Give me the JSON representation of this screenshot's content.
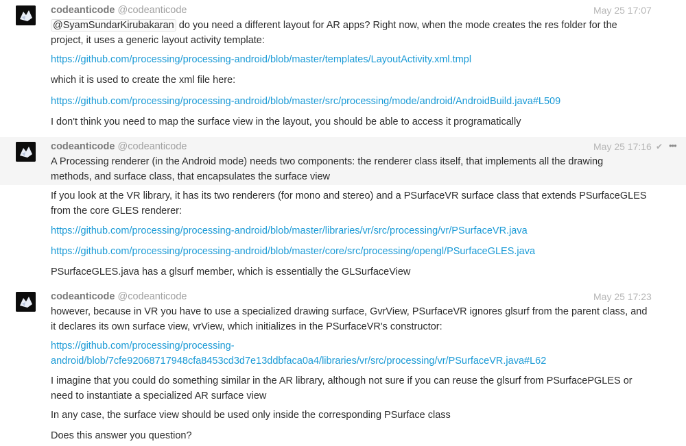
{
  "messages": [
    {
      "author": "codeanticode",
      "handle": "@codeanticode",
      "time": "May 25 17:07",
      "mention": "@SyamSundarKirubakaran",
      "lines": [
        " do you need a different layout for AR apps? Right now, when the mode creates the res folder for the",
        "project, it uses a generic layout activity template:"
      ],
      "paragraphs": [
        "https://github.com/processing/processing-android/blob/master/templates/LayoutActivity.xml.tmpl",
        "which it is used to create the xml file here:",
        "https://github.com/processing/processing-android/blob/master/src/processing/mode/android/AndroidBuild.java#L509",
        "I don't think you need to map the surface view in the layout, you should be able to access it programatically"
      ]
    },
    {
      "author": "codeanticode",
      "handle": "@codeanticode",
      "time": "May 25 17:16",
      "check": "✔",
      "more": "•••",
      "lines": [
        "A Processing renderer (in the Android mode) needs two components: the renderer class itself, that implements all the drawing",
        "methods, and surface class, that encapsulates the surface view"
      ],
      "paragraphs": [
        "If you look at the VR library, it has its two renderers (for mono and stereo) and a PSurfaceVR surface class that extends PSurfaceGLES",
        "from the core GLES renderer:",
        "https://github.com/processing/processing-android/blob/master/libraries/vr/src/processing/vr/PSurfaceVR.java",
        "https://github.com/processing/processing-android/blob/master/core/src/processing/opengl/PSurfaceGLES.java",
        "PSurfaceGLES.java has a glsurf member, which is essentially the GLSurfaceView"
      ]
    },
    {
      "author": "codeanticode",
      "handle": "@codeanticode",
      "time": "May 25 17:23",
      "lines": [
        "however, because in VR you have to use a specialized drawing surface, GvrView, PSurfaceVR ignores glsurf from the parent class, and",
        "it declares its own surface view, vrView, which initializes in the PSurfaceVR's constructor:"
      ],
      "paragraphs": [
        "https://github.com/processing/processing-",
        "android/blob/7cfe92068717948cfa8453cd3d7e13ddbfaca0a4/libraries/vr/src/processing/vr/PSurfaceVR.java#L62",
        "I imagine that you could do something similar in the AR library, although not sure if you can reuse the glsurf from PSurfacePGLES or",
        "need to instantiate a specialized AR surface view",
        "In any case, the surface view should be used only inside the corresponding PSurface class",
        "Does this answer you question?"
      ]
    }
  ]
}
